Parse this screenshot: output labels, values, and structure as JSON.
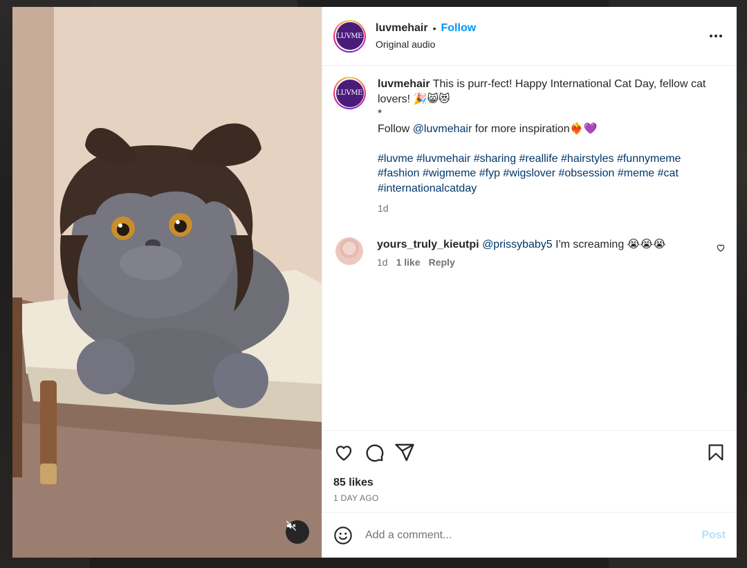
{
  "header": {
    "avatar_text": "LUVME",
    "username": "luvmehair",
    "separator": "•",
    "follow_label": "Follow",
    "subtitle": "Original audio"
  },
  "caption": {
    "avatar_text": "LUVME",
    "username": "luvmehair",
    "text_line1": "This is purr-fect! Happy International Cat Day, fellow cat lovers! 🎉😸😻",
    "asterisk": "*",
    "follow_prefix": "Follow ",
    "mention": "@luvmehair",
    "follow_suffix": " for more inspiration❤️‍🔥💜",
    "hashtags": "#luvme #luvmehair #sharing #reallife #hairstyles #funnymeme #fashion #wigmeme #fyp #wigslover #obsession #meme #cat #internationalcatday",
    "age": "1d"
  },
  "comment": {
    "username": "yours_truly_kieutpi",
    "mention": "@prissybaby5",
    "text": " I'm screaming 😭😭😭",
    "age": "1d",
    "likes": "1 like",
    "reply_label": "Reply"
  },
  "actions": {
    "likes_count": "85 likes",
    "time_ago": "1 DAY AGO"
  },
  "compose": {
    "placeholder": "Add a comment...",
    "post_label": "Post"
  },
  "icons": {
    "more": "more-horizontal-icon",
    "like": "heart-icon",
    "comment": "comment-icon",
    "share": "send-icon",
    "save": "bookmark-icon",
    "emoji": "emoji-icon",
    "mute": "muted-speaker-icon"
  },
  "colors": {
    "follow": "#0095f6",
    "link": "#00376b",
    "post_disabled": "#b2dffc",
    "avatar_bg": "#4a1c7a"
  }
}
